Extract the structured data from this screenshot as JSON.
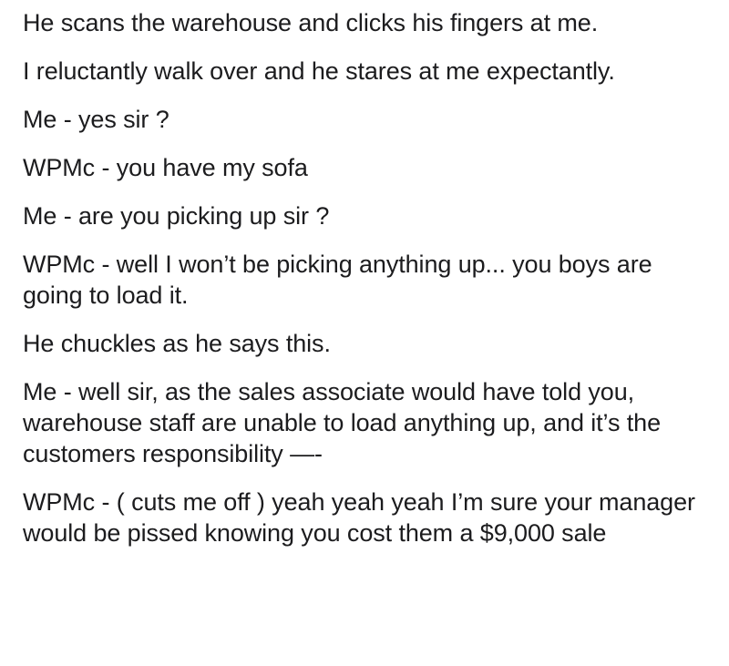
{
  "post": {
    "paragraphs": [
      "He scans the warehouse and clicks his fingers at me.",
      "I reluctantly walk over and he stares at me expectantly.",
      "Me - yes sir ?",
      "WPMc - you have my sofa",
      "Me - are you picking up sir ?",
      "WPMc - well I won’t be picking anything up... you boys are going to load it.",
      "He chuckles as he says this.",
      "Me - well sir, as the sales associate would have told you, warehouse staff are unable to load anything up, and it’s the customers responsibility —-",
      "WPMc - ( cuts me off ) yeah yeah yeah I’m sure your manager would be pissed knowing you cost them a $9,000 sale"
    ]
  }
}
